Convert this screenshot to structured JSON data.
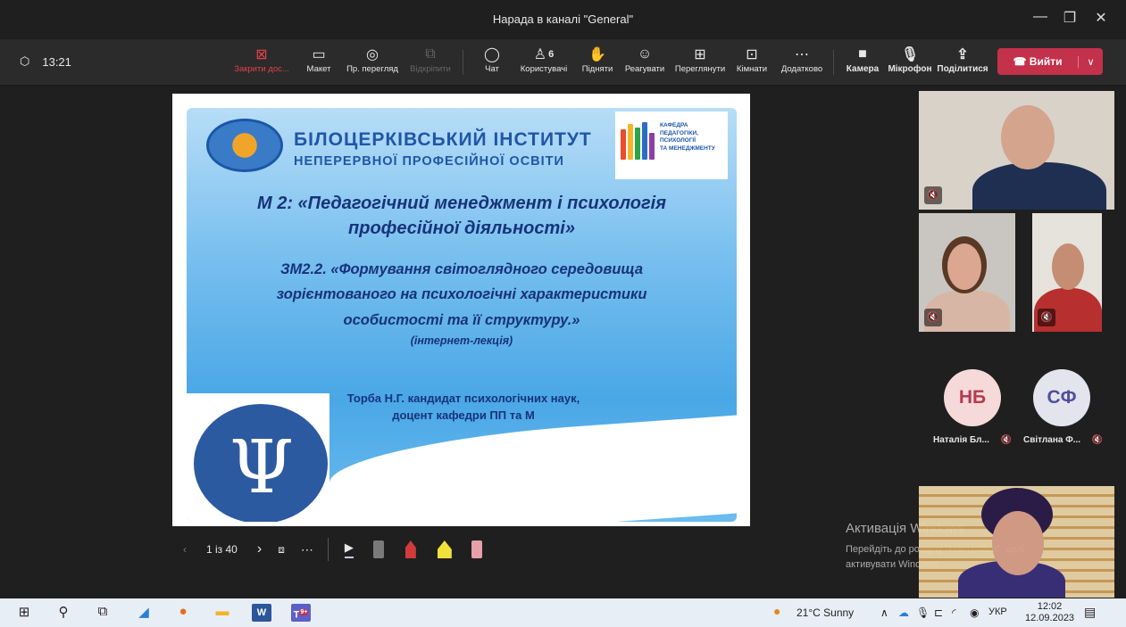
{
  "window": {
    "title": "Нарада в каналі \"General\""
  },
  "timer": "13:21",
  "toolbar": {
    "stop_share": "Закрити дос...",
    "layout": "Макет",
    "preview": "Пр. перегляд",
    "unpin": "Відкріпити",
    "chat": "Чат",
    "people_count": "6",
    "people": "Користувачі",
    "raise": "Підняти",
    "react": "Реагувати",
    "view": "Переглянути",
    "rooms": "Кімнати",
    "more": "Додатково",
    "camera": "Камера",
    "mic": "Мікрофон",
    "share": "Поділитися",
    "leave": "Вийти"
  },
  "slide": {
    "inst_line1": "БІЛОЦЕРКІВСЬКИЙ ІНСТИТУТ",
    "inst_line2": "НЕПЕРЕРВНОЇ ПРОФЕСІЙНОЇ ОСВІТИ",
    "dept": "КАФЕДРА\nПЕДАГОГІКИ,\nПСИХОЛОГІЇ\nТА МЕНЕДЖМЕНТУ",
    "module1": "М 2: «Педагогічний менеджмент і психологія",
    "module2": "професійної діяльності»",
    "sub1": "ЗМ2.2.  «Формування світоглядного середовища",
    "sub2": "зорієнтованого на психологічні характеристики",
    "sub3": "особистості та її структуру.»",
    "sub4": "(інтернет-лекція)",
    "teacher1": "Торба Н.Г. кандидат психологічних  наук,",
    "teacher2": "доцент кафедри ПП та М"
  },
  "slide_nav": {
    "page": "1 із 40"
  },
  "participants": [
    {
      "initials": "НБ",
      "name": "Наталія Бл..."
    },
    {
      "initials": "СФ",
      "name": "Світлана Ф..."
    }
  ],
  "watermark": {
    "line1": "Активація Windows",
    "line2": "Перейдіть до розділу \"Настройки\", щоб",
    "line3": "активувати Windows."
  },
  "taskbar": {
    "weather": "21°C  Sunny",
    "lang": "УКР",
    "time": "12:02",
    "date": "12.09.2023",
    "teams_badge": "9+"
  },
  "colors": {
    "leave": "#c4314b",
    "slide_blue": "#4aa7e6",
    "avatar_nb": "#f6d9d9",
    "avatar_sf": "#e4e4ef"
  }
}
